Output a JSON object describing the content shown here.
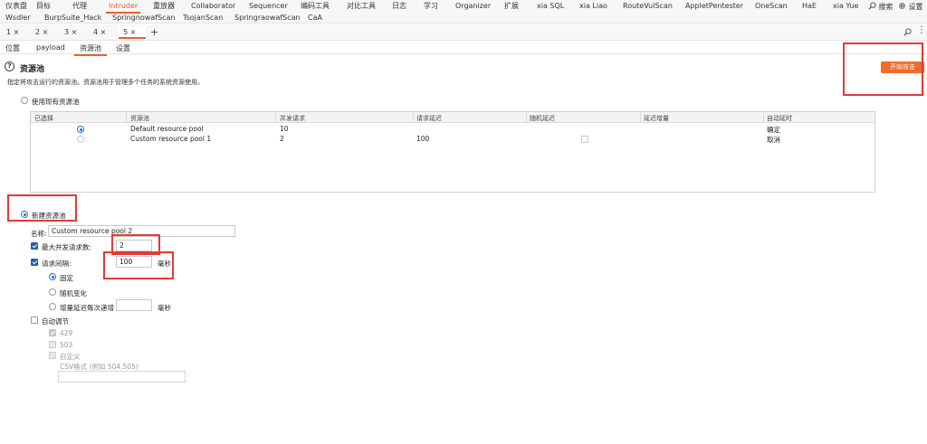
{
  "menu": {
    "row1": [
      "仪表盘",
      "目标",
      "代理",
      "Intruder",
      "重放器",
      "Collaborator",
      "Sequencer",
      "编码工具",
      "对比工具",
      "日志",
      "学习",
      "Organizer",
      "扩展",
      "xia SQL",
      "xia Liao",
      "RouteVulScan",
      "AppletPentester",
      "OneScan",
      "HaE",
      "xia Yue"
    ],
    "row2": [
      "Wsdler",
      "BurpSuite_Hack",
      "SpringnowafScan",
      "TsojanScan",
      "SpringraowafScan",
      "CaA"
    ],
    "search_label": "搜索",
    "settings_label": "设置",
    "active": "Intruder"
  },
  "instance_tabs": [
    "1 ×",
    "2 ×",
    "3 ×",
    "4 ×",
    "5 ×"
  ],
  "add_tab": "+",
  "subtabs": [
    "位置",
    "payload",
    "资源池",
    "设置"
  ],
  "section": {
    "title": "资源池",
    "description": "指定将攻击运行的资源池。资源池用于管理多个任务的系统资源使用。",
    "start_button": "开始攻击"
  },
  "use_existing": {
    "label": "使用现有资源池"
  },
  "table": {
    "headers": [
      "已选择",
      "资源池",
      "并发请求",
      "请求延迟",
      "随机延迟",
      "延迟增量",
      "自动延时"
    ],
    "rows": [
      {
        "name": "Default resource pool",
        "concurrent": "10",
        "delay": "",
        "auto": "确定"
      },
      {
        "name": "Custom resource pool 1",
        "concurrent": "2",
        "delay": "100",
        "auto": "取消"
      }
    ]
  },
  "new_pool": {
    "label": "新建资源池",
    "name_label": "名称:",
    "name_value": "Custom resource pool 2",
    "max_concurrent_label": "最大并发请求数:",
    "max_concurrent_value": "2",
    "interval_label": "请求间隔:",
    "interval_value": "100",
    "ms_unit": "毫秒",
    "fixed_label": "固定",
    "random_label": "随机变化",
    "increment_label": "增量延迟每次递增",
    "increment_unit": "毫秒",
    "auto_adjust_label": "自动调节",
    "code_429": "429",
    "code_503": "503",
    "custom_label": "自定义",
    "csv_label": "CSV格式 (例如 504,505)"
  }
}
